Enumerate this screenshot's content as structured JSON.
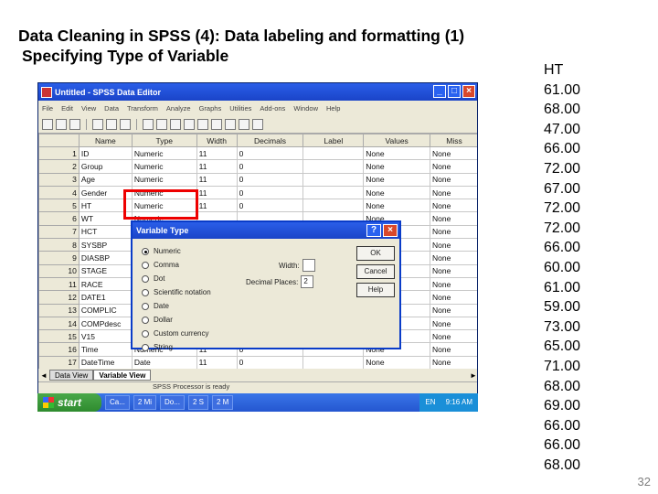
{
  "slide": {
    "title": "Data Cleaning in SPSS (4): Data labeling and formatting (1)",
    "subtitle": "Specifying Type of Variable",
    "page_number": "32"
  },
  "ht_column": {
    "header": "HT",
    "values": [
      "61.00",
      "68.00",
      "47.00",
      "66.00",
      "72.00",
      "67.00",
      "72.00",
      "72.00",
      "66.00",
      "60.00",
      "61.00",
      "59.00",
      "73.00",
      "65.00",
      "71.00",
      "68.00",
      "69.00",
      "66.00",
      "66.00",
      "68.00"
    ]
  },
  "window": {
    "title": "Untitled - SPSS Data Editor",
    "menus": [
      "File",
      "Edit",
      "View",
      "Data",
      "Transform",
      "Analyze",
      "Graphs",
      "Utilities",
      "Add-ons",
      "Window",
      "Help"
    ],
    "columns": [
      "",
      "Name",
      "Type",
      "Width",
      "Decimals",
      "Label",
      "Values",
      "Miss"
    ],
    "rows": [
      {
        "n": "1",
        "name": "ID",
        "type": "Numeric",
        "width": "11",
        "dec": "0",
        "values": "None",
        "miss": "None"
      },
      {
        "n": "2",
        "name": "Group",
        "type": "Numeric",
        "width": "11",
        "dec": "0",
        "values": "None",
        "miss": "None"
      },
      {
        "n": "3",
        "name": "Age",
        "type": "Numeric",
        "width": "11",
        "dec": "0",
        "values": "None",
        "miss": "None"
      },
      {
        "n": "4",
        "name": "Gender",
        "type": "Numeric",
        "width": "11",
        "dec": "0",
        "values": "None",
        "miss": "None"
      },
      {
        "n": "5",
        "name": "HT",
        "type": "Numeric",
        "width": "11",
        "dec": "0",
        "values": "None",
        "miss": "None"
      },
      {
        "n": "6",
        "name": "WT",
        "type": "Numeric",
        "width": "",
        "dec": "",
        "values": "None",
        "miss": "None"
      },
      {
        "n": "7",
        "name": "HCT",
        "type": "",
        "width": "",
        "dec": "",
        "values": "None",
        "miss": "None"
      },
      {
        "n": "8",
        "name": "SYSBP",
        "type": "",
        "width": "",
        "dec": "",
        "values": "None",
        "miss": "None"
      },
      {
        "n": "9",
        "name": "DIASBP",
        "type": "",
        "width": "",
        "dec": "",
        "values": "None",
        "miss": "None"
      },
      {
        "n": "10",
        "name": "STAGE",
        "type": "",
        "width": "",
        "dec": "",
        "values": "None",
        "miss": "None"
      },
      {
        "n": "11",
        "name": "RACE",
        "type": "",
        "width": "",
        "dec": "",
        "values": "None",
        "miss": "None"
      },
      {
        "n": "12",
        "name": "DATE1",
        "type": "",
        "width": "",
        "dec": "",
        "values": "None",
        "miss": "None"
      },
      {
        "n": "13",
        "name": "COMPLIC",
        "type": "",
        "width": "",
        "dec": "",
        "values": "None",
        "miss": "None"
      },
      {
        "n": "14",
        "name": "COMPdesc",
        "type": "",
        "width": "",
        "dec": "",
        "values": "None",
        "miss": "None"
      },
      {
        "n": "15",
        "name": "V15",
        "type": "",
        "width": "",
        "dec": "",
        "values": "None",
        "miss": "None"
      },
      {
        "n": "16",
        "name": "Time",
        "type": "Numeric",
        "width": "11",
        "dec": "0",
        "values": "None",
        "miss": "None"
      },
      {
        "n": "17",
        "name": "DateTime",
        "type": "Date",
        "width": "11",
        "dec": "0",
        "values": "None",
        "miss": "None"
      }
    ],
    "tabs": [
      "Data View",
      "Variable View"
    ],
    "status": "SPSS Processor  is ready"
  },
  "dialog": {
    "title": "Variable Type",
    "options": [
      "Numeric",
      "Comma",
      "Dot",
      "Scientific notation",
      "Date",
      "Dollar",
      "Custom currency",
      "String"
    ],
    "selected_index": 0,
    "width_label": "Width:",
    "width_value": "",
    "decimal_label": "Decimal Places:",
    "decimal_value": "2",
    "buttons": {
      "ok": "OK",
      "cancel": "Cancel",
      "help": "Help"
    }
  },
  "taskbar": {
    "start": "start",
    "items": [
      "Ca...",
      "2 Mi",
      "Do...",
      "2 S",
      "2 M"
    ],
    "lang": "EN",
    "clock": "9:16 AM"
  }
}
